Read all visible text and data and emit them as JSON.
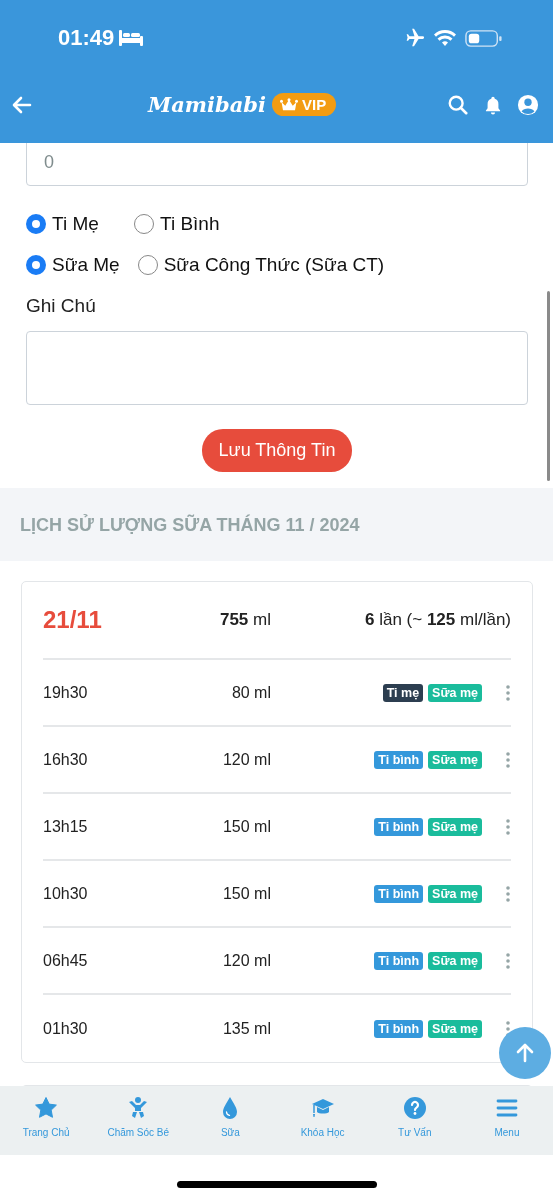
{
  "status_bar": {
    "time": "01:49"
  },
  "header": {
    "logo": "Mamibabi",
    "badge": "VIP"
  },
  "form": {
    "amount_field": {
      "placeholder": "0"
    },
    "radio_groups": [
      {
        "options": [
          {
            "label": "Ti Mẹ",
            "selected": true
          },
          {
            "label": "Ti Bình",
            "selected": false
          }
        ]
      },
      {
        "options": [
          {
            "label": "Sữa Mẹ",
            "selected": true
          },
          {
            "label": "Sữa Công Thức (Sữa CT)",
            "selected": false
          }
        ]
      }
    ],
    "note_label": "Ghi Chú",
    "save_button": "Lưu Thông Tin"
  },
  "history": {
    "title": "LỊCH SỬ LƯỢNG SỮA THÁNG 11 / 2024",
    "days": [
      {
        "date": "21/11",
        "total": "**755** ml",
        "count": "**6** lần (~ **125** ml/lần)",
        "entries": [
          {
            "time": "19h30",
            "amount": "80 ml",
            "tags": [
              {
                "label": "Ti mẹ",
                "color": "#2c3e50"
              },
              {
                "label": "Sữa mẹ",
                "color": "#1abc9c"
              }
            ]
          },
          {
            "time": "16h30",
            "amount": "120 ml",
            "tags": [
              {
                "label": "Ti bình",
                "color": "#3498db"
              },
              {
                "label": "Sữa mẹ",
                "color": "#1abc9c"
              }
            ]
          },
          {
            "time": "13h15",
            "amount": "150 ml",
            "tags": [
              {
                "label": "Ti bình",
                "color": "#3498db"
              },
              {
                "label": "Sữa mẹ",
                "color": "#1abc9c"
              }
            ]
          },
          {
            "time": "10h30",
            "amount": "150 ml",
            "tags": [
              {
                "label": "Ti bình",
                "color": "#3498db"
              },
              {
                "label": "Sữa mẹ",
                "color": "#1abc9c"
              }
            ]
          },
          {
            "time": "06h45",
            "amount": "120 ml",
            "tags": [
              {
                "label": "Ti bình",
                "color": "#3498db"
              },
              {
                "label": "Sữa mẹ",
                "color": "#1abc9c"
              }
            ]
          },
          {
            "time": "01h30",
            "amount": "135 ml",
            "tags": [
              {
                "label": "Ti bình",
                "color": "#3498db"
              },
              {
                "label": "Sữa mẹ",
                "color": "#1abc9c"
              }
            ]
          }
        ]
      }
    ]
  },
  "bottom_nav": [
    {
      "kind": "star",
      "label": "Trang Chủ"
    },
    {
      "kind": "baby",
      "label": "Chăm Sóc Bé"
    },
    {
      "kind": "drop",
      "label": "Sữa"
    },
    {
      "kind": "cap",
      "label": "Khóa Học"
    },
    {
      "kind": "help",
      "label": "Tư Vấn"
    },
    {
      "kind": "menu",
      "label": "Menu"
    }
  ]
}
